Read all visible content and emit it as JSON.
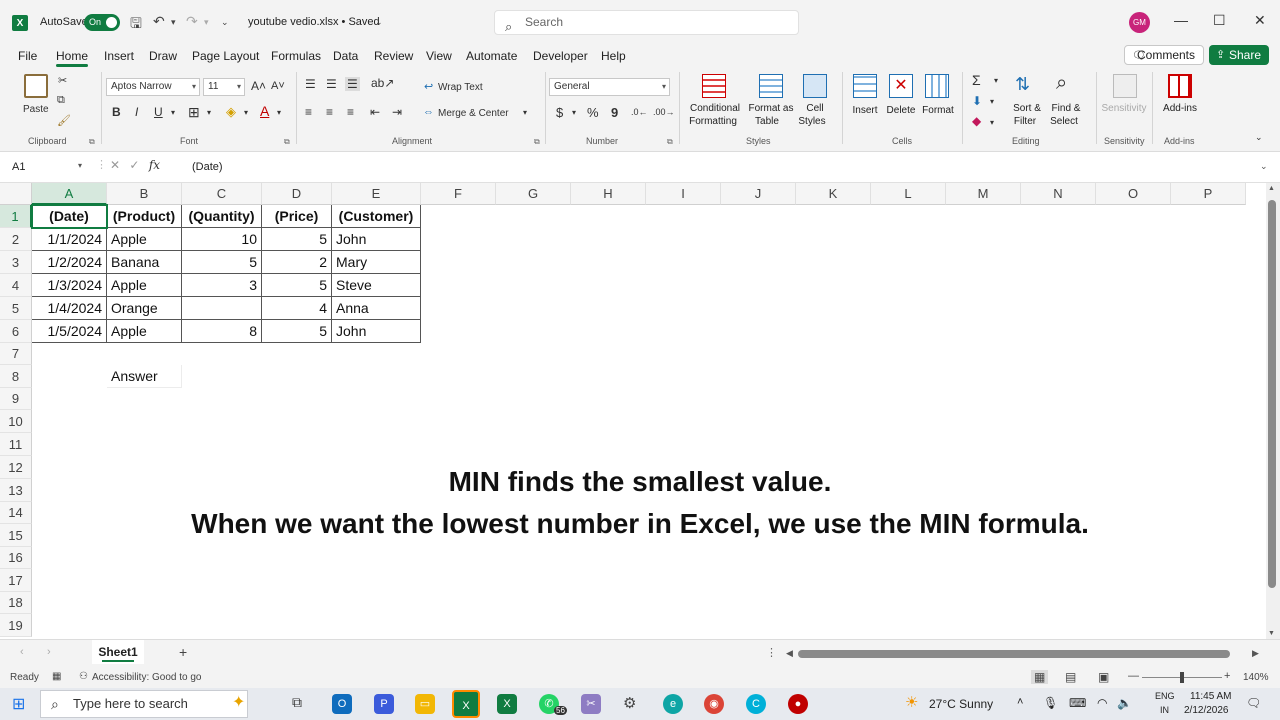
{
  "titlebar": {
    "autosave_label": "AutoSave",
    "autosave_state": "On",
    "file_title": "youtube vedio.xlsx • Saved",
    "search_placeholder": "Search",
    "avatar_initials": "GM"
  },
  "menu": {
    "items": [
      "File",
      "Home",
      "Insert",
      "Draw",
      "Page Layout",
      "Formulas",
      "Data",
      "Review",
      "View",
      "Automate",
      "Developer",
      "Help"
    ],
    "active": "Home",
    "comments_label": "Comments",
    "share_label": "Share"
  },
  "ribbon": {
    "clipboard": {
      "paste": "Paste",
      "label": "Clipboard"
    },
    "font": {
      "name": "Aptos Narrow",
      "size": "11",
      "label": "Font",
      "bold": "B",
      "italic": "I",
      "underline": "U"
    },
    "alignment": {
      "wrap_text": "Wrap Text",
      "merge_center": "Merge & Center",
      "label": "Alignment"
    },
    "number": {
      "format": "General",
      "label": "Number",
      "currency": "$",
      "percent": "%",
      "comma": "9"
    },
    "styles": {
      "conditional": "Conditional",
      "conditional2": "Formatting",
      "format_as": "Format as",
      "format_as2": "Table",
      "cell": "Cell",
      "cell2": "Styles",
      "label": "Styles"
    },
    "cells": {
      "insert": "Insert",
      "delete": "Delete",
      "format": "Format",
      "label": "Cells"
    },
    "editing": {
      "sort": "Sort &",
      "sort2": "Filter",
      "find": "Find &",
      "find2": "Select",
      "label": "Editing"
    },
    "sensitivity": {
      "btn": "Sensitivity",
      "label": "Sensitivity"
    },
    "addins": {
      "btn": "Add-ins",
      "label": "Add-ins"
    }
  },
  "formula_bar": {
    "name_box": "A1",
    "fx": "fx",
    "value": "(Date)"
  },
  "grid": {
    "columns": [
      "A",
      "B",
      "C",
      "D",
      "E",
      "F",
      "G",
      "H",
      "I",
      "J",
      "K",
      "L",
      "M",
      "N",
      "O",
      "P"
    ],
    "rows": [
      "1",
      "2",
      "3",
      "4",
      "5",
      "6",
      "7",
      "8",
      "9",
      "10",
      "11",
      "12",
      "13",
      "14",
      "15",
      "16",
      "17",
      "18",
      "19"
    ],
    "selected_cell": "A1",
    "headers": [
      "(Date)",
      "(Product)",
      "(Quantity)",
      "(Price)",
      "(Customer)"
    ],
    "data": [
      [
        "1/1/2024",
        "Apple",
        "10",
        "5",
        "John"
      ],
      [
        "1/2/2024",
        "Banana",
        "5",
        "2",
        "Mary"
      ],
      [
        "1/3/2024",
        "Apple",
        "3",
        "5",
        "Steve"
      ],
      [
        "1/4/2024",
        "Orange",
        "",
        "4",
        "Anna"
      ],
      [
        "1/5/2024",
        "Apple",
        "8",
        "5",
        "John"
      ]
    ],
    "answer_label": "Answer"
  },
  "overlay": {
    "line1": "MIN finds the smallest value.",
    "line2": "When we want the lowest number in Excel, we use the MIN formula."
  },
  "sheets": {
    "tabs": [
      "Sheet1"
    ],
    "active": "Sheet1"
  },
  "status": {
    "mode": "Ready",
    "accessibility": "Accessibility: Good to go",
    "zoom": "140%"
  },
  "taskbar": {
    "search_placeholder": "Type here to search",
    "weather": "27°C  Sunny",
    "lang": "ENG",
    "region": "IN",
    "time": "11:45 AM",
    "date": "2/12/2026",
    "badge": "56"
  },
  "colors": {
    "accent": "#107c41",
    "avatar": "#c8237a"
  }
}
